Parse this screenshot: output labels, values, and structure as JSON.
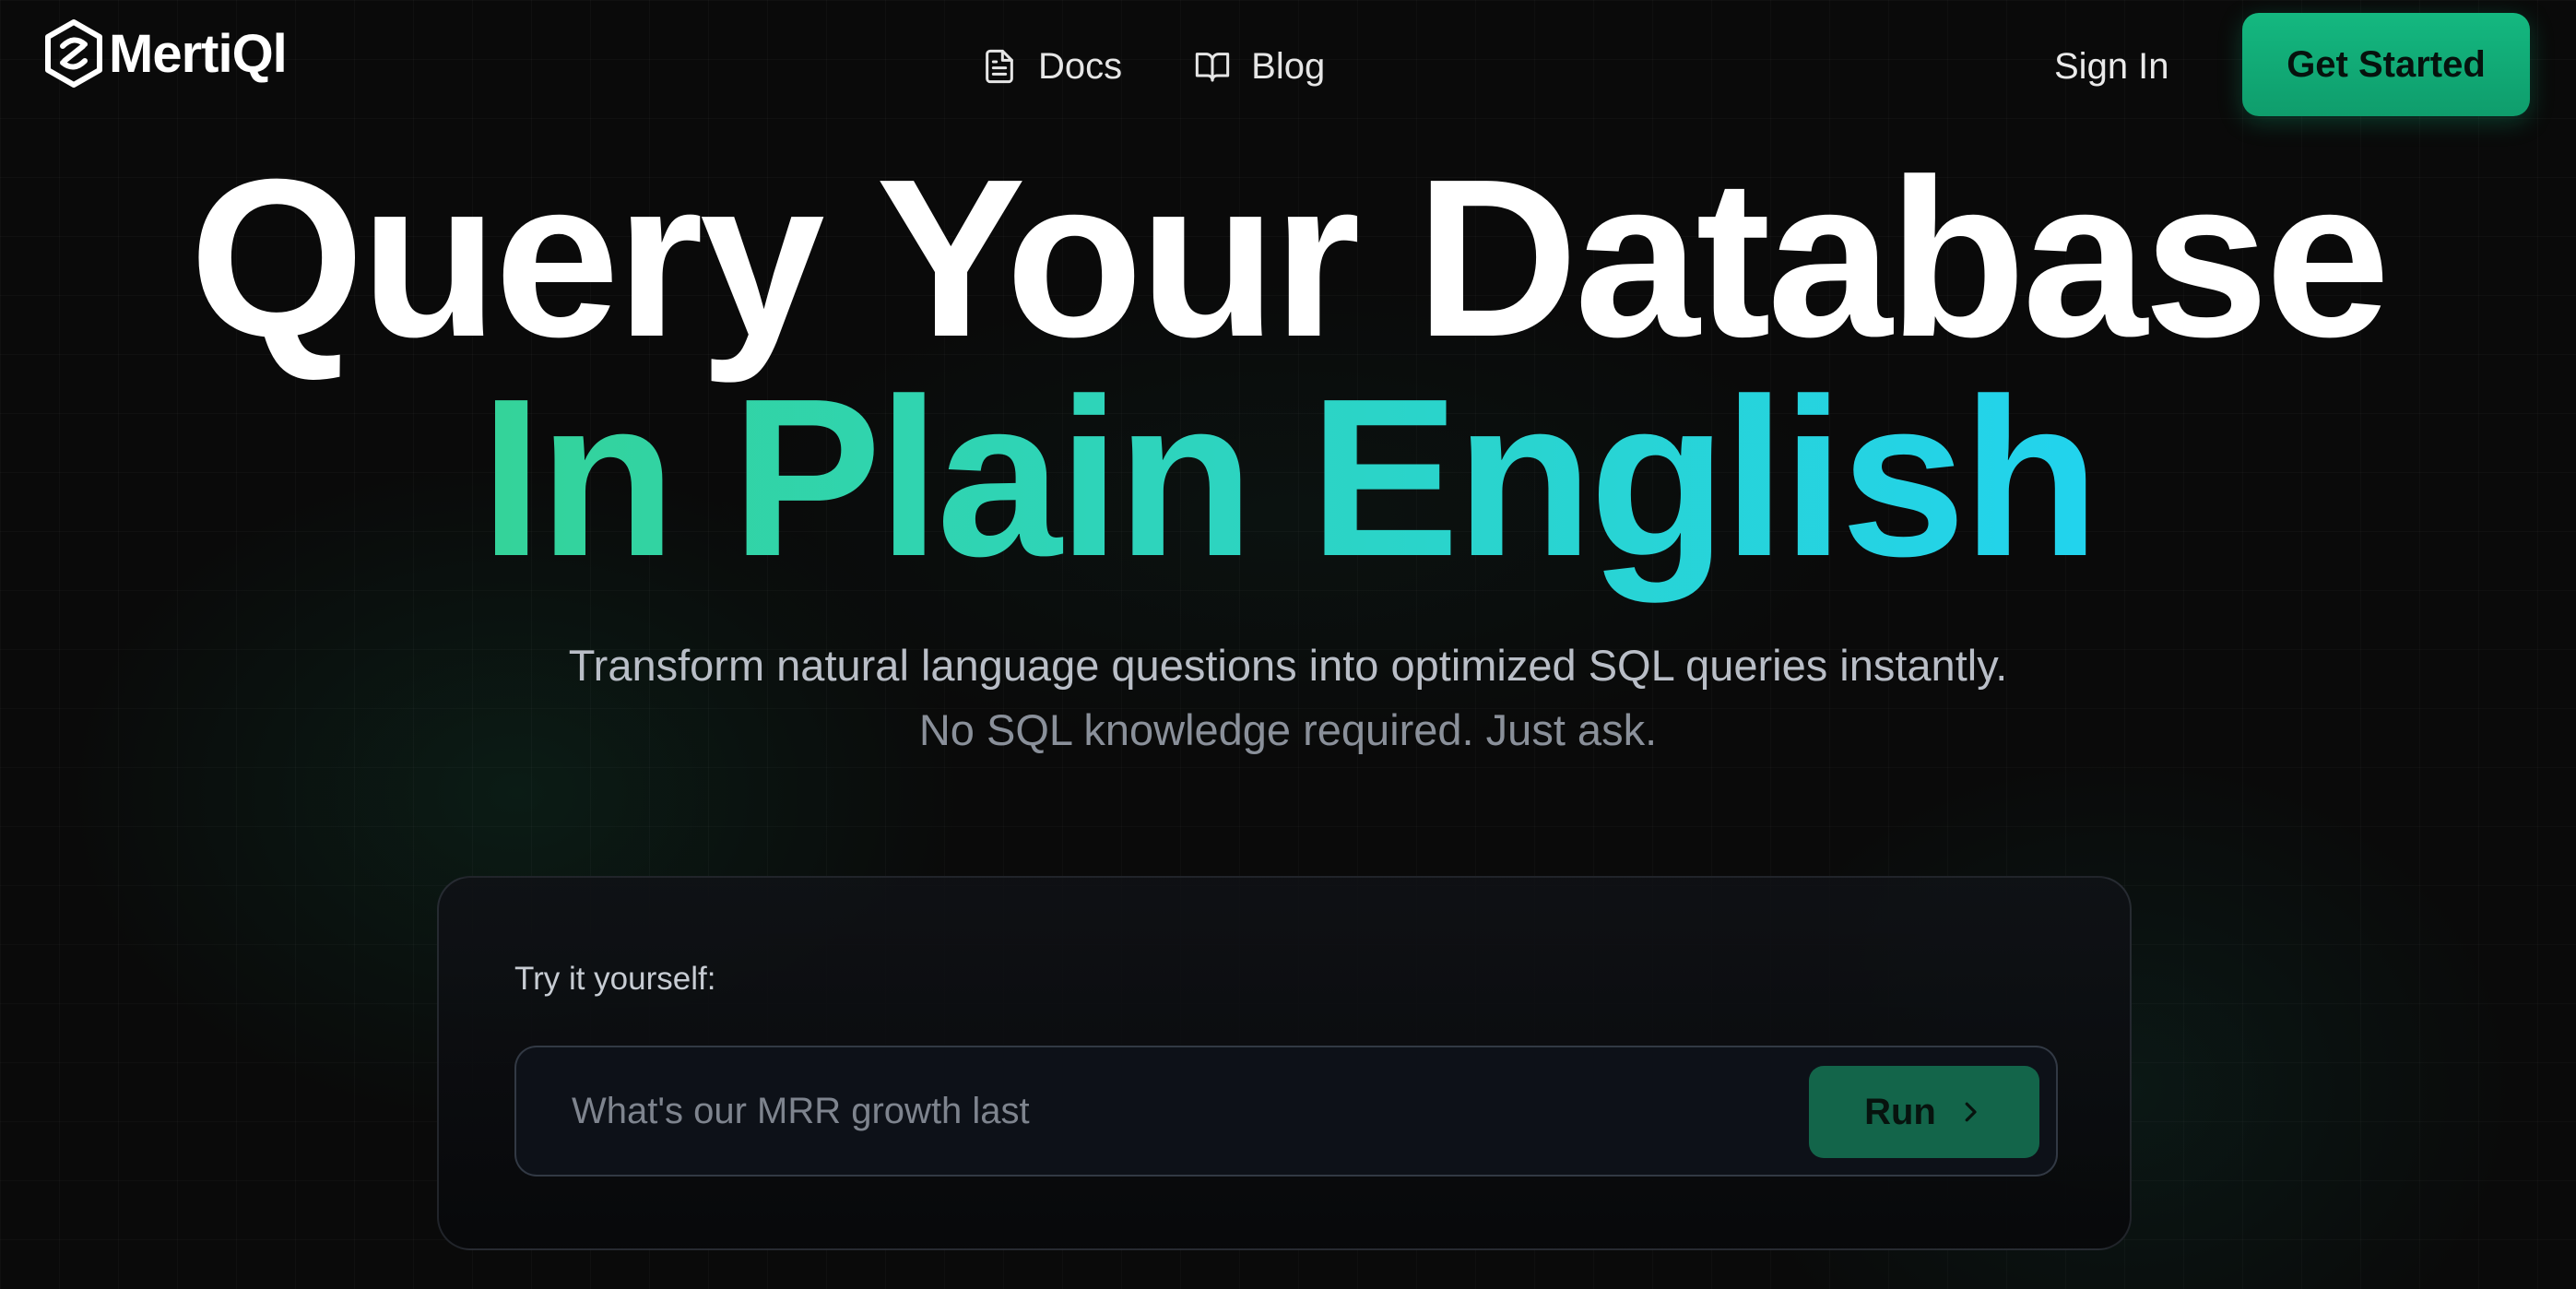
{
  "nav": {
    "logo_text": "MertiQl",
    "links": [
      {
        "label": "Docs",
        "icon": "document-icon"
      },
      {
        "label": "Blog",
        "icon": "book-icon"
      }
    ],
    "sign_in": "Sign In",
    "get_started": "Get Started"
  },
  "hero": {
    "line1": "Query Your Database",
    "line2": "In Plain English",
    "subtitle1": "Transform natural language questions into optimized SQL queries instantly.",
    "subtitle2": "No SQL knowledge required. Just ask."
  },
  "demo": {
    "label": "Try it yourself:",
    "input_value": "What's our MRR growth last",
    "run_label": "Run",
    "run_icon": "chevron-right-icon"
  },
  "colors": {
    "background": "#0a0a0a",
    "accent_green": "#10b981",
    "gradient_start": "#34d399",
    "gradient_end": "#22d3ee",
    "run_button": "#13654a"
  }
}
